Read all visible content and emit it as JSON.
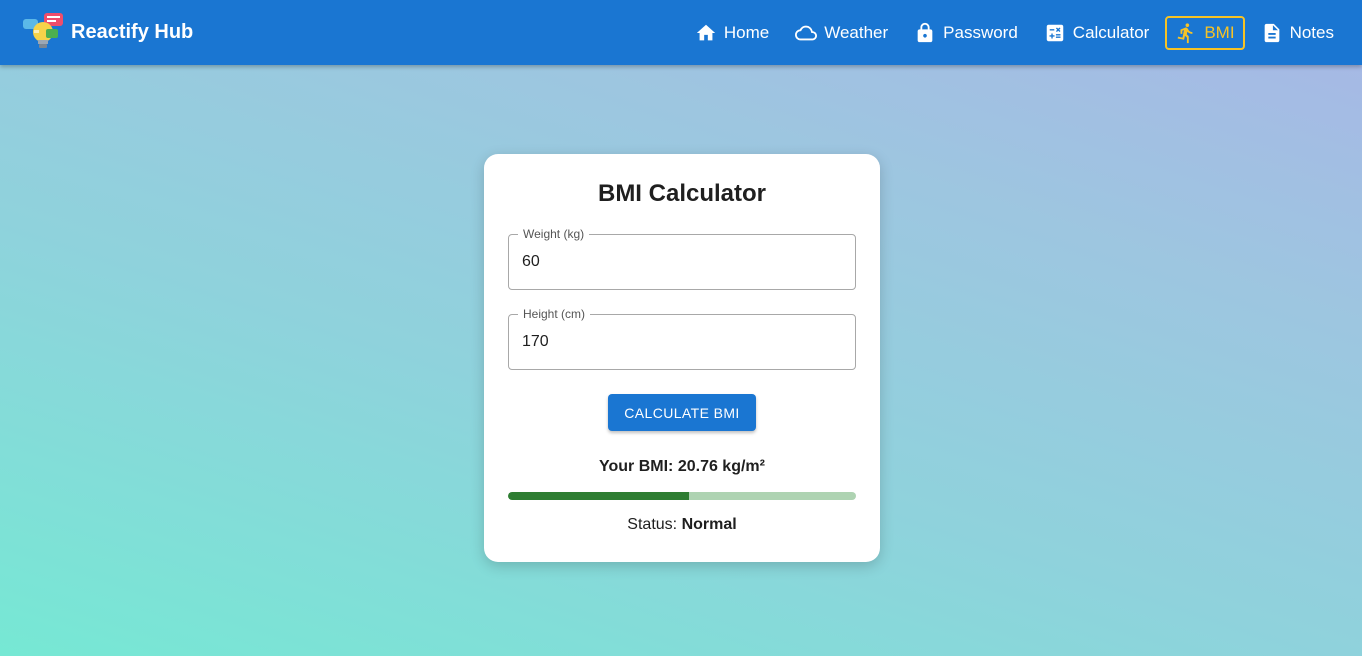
{
  "header": {
    "app_name": "Reactify Hub",
    "accent_color": "#1a76d2",
    "active_color": "#f7c325",
    "nav": [
      {
        "label": "Home",
        "icon": "home-icon"
      },
      {
        "label": "Weather",
        "icon": "cloud-icon"
      },
      {
        "label": "Password",
        "icon": "lock-icon"
      },
      {
        "label": "Calculator",
        "icon": "calculator-icon"
      },
      {
        "label": "BMI",
        "icon": "running-person-icon",
        "active": true
      },
      {
        "label": "Notes",
        "icon": "document-icon"
      }
    ]
  },
  "bmi_card": {
    "title": "BMI Calculator",
    "weight": {
      "label": "Weight (kg)",
      "value": "60"
    },
    "height": {
      "label": "Height (cm)",
      "value": "170"
    },
    "calculate_label": "CALCULATE BMI",
    "result_text": "Your BMI: 20.76 kg/m²",
    "progress_fraction": 0.52,
    "status_prefix": "Status:",
    "status_value": "Normal"
  }
}
